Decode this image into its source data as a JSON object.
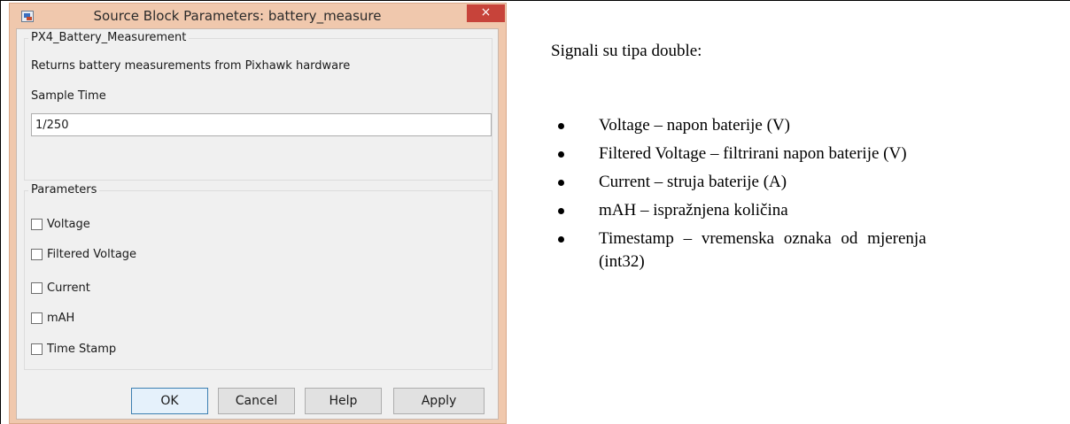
{
  "dialog": {
    "title": "Source Block Parameters: battery_measure",
    "close_glyph": "×",
    "block_name": "PX4_Battery_Measurement",
    "description": "Returns battery measurements from Pixhawk hardware",
    "sample_time_label": "Sample Time",
    "sample_time_value": "1/250",
    "parameters_label": "Parameters",
    "checkboxes": [
      {
        "label": "Voltage",
        "checked": false
      },
      {
        "label": "Filtered Voltage",
        "checked": false
      },
      {
        "label": "Current",
        "checked": false
      },
      {
        "label": "mAH",
        "checked": false
      },
      {
        "label": "Time Stamp",
        "checked": false
      }
    ],
    "buttons": {
      "ok": "OK",
      "cancel": "Cancel",
      "help": "Help",
      "apply": "Apply"
    },
    "icons": {
      "app": "simulink-block-icon",
      "close": "close-icon"
    },
    "colors": {
      "titlebar": "#f0c8ad",
      "close": "#c7433a",
      "client": "#f0f0f0"
    }
  },
  "document": {
    "intro": "Signali su tipa double:",
    "bullets": [
      "Voltage – napon baterije (V)",
      "Filtered Voltage – filtrirani napon baterije (V)",
      "Current – struja baterije (A)",
      "mAH – ispražnjena količina"
    ],
    "last_bullet_line1": "Timestamp – vremenska oznaka od mjerenja",
    "last_bullet_line2": "(int32)"
  }
}
